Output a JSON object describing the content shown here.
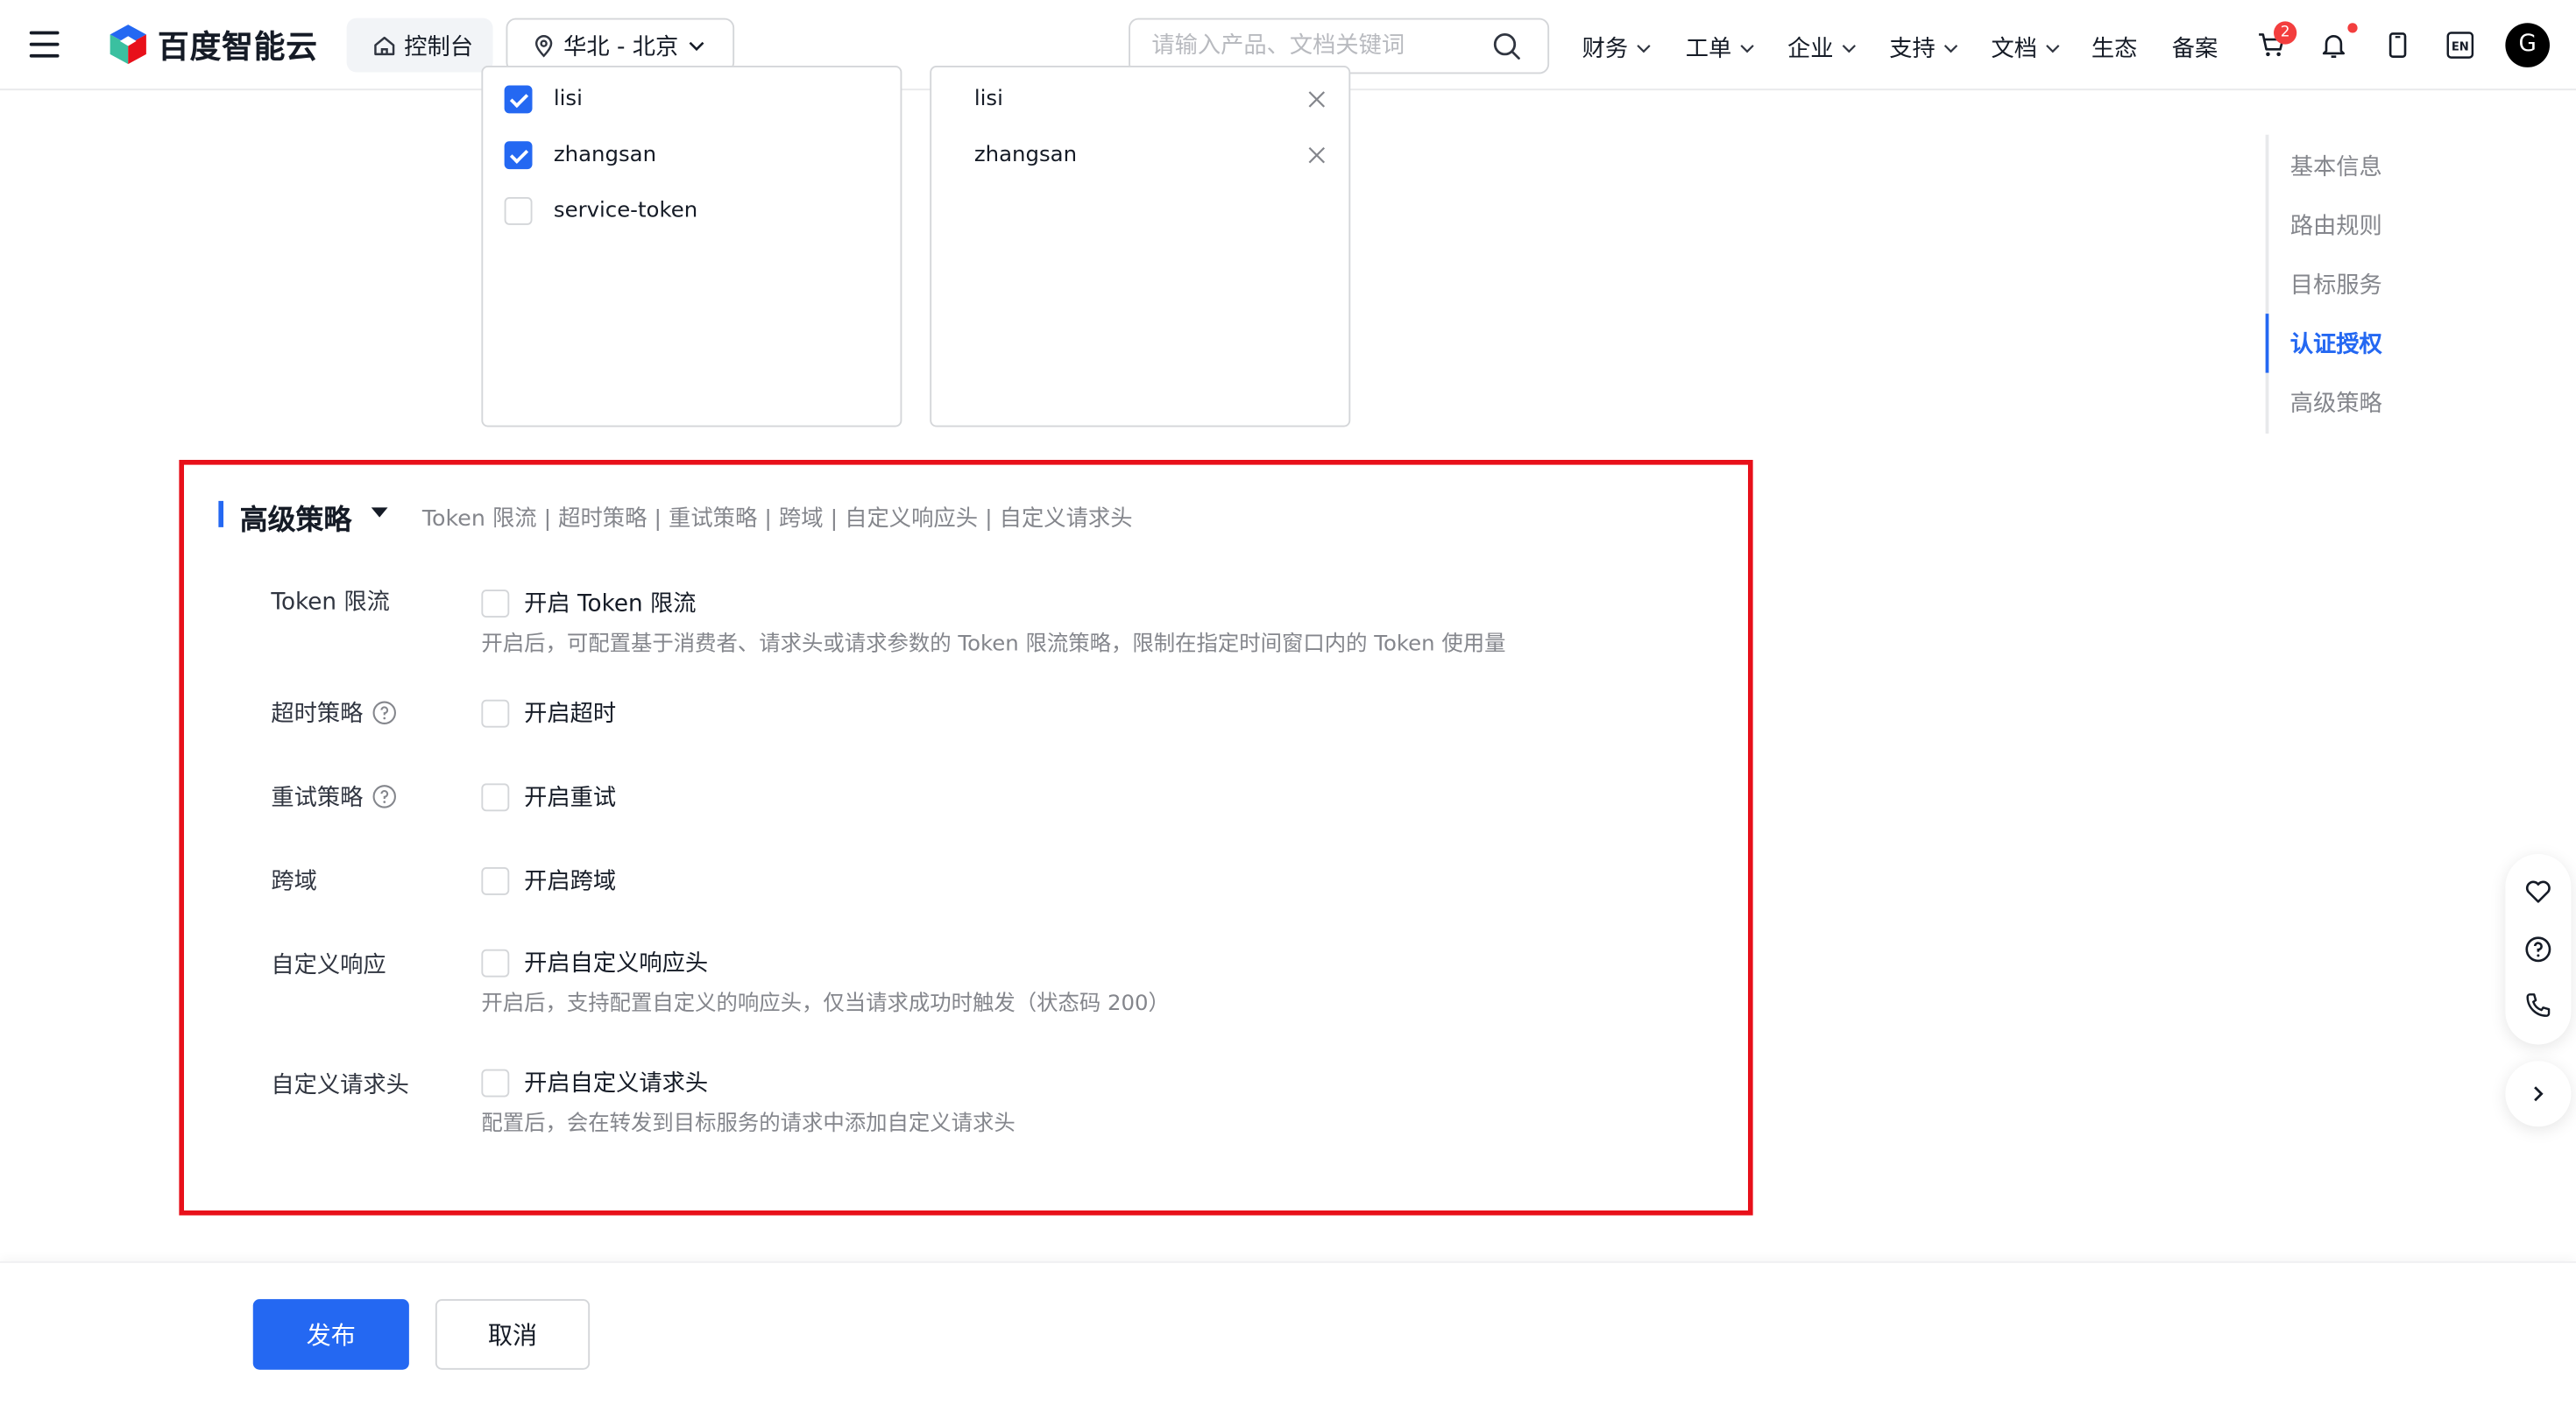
{
  "nav": {
    "brand": "百度智能云",
    "console": "控制台",
    "region": "华北 - 北京",
    "search_placeholder": "请输入产品、文档关键词",
    "menus": [
      "财务",
      "工单",
      "企业",
      "支持",
      "文档",
      "生态",
      "备案"
    ],
    "cart_count": "2",
    "lang": "EN",
    "avatar_letter": "G"
  },
  "transfer": {
    "source_items": [
      {
        "label": "lisi",
        "checked": true
      },
      {
        "label": "zhangsan",
        "checked": true
      },
      {
        "label": "service-token",
        "checked": false
      }
    ],
    "target_items": [
      {
        "label": "lisi"
      },
      {
        "label": "zhangsan"
      }
    ]
  },
  "anchor_nav": {
    "items": [
      "基本信息",
      "路由规则",
      "目标服务",
      "认证授权",
      "高级策略"
    ],
    "active": "认证授权"
  },
  "advanced": {
    "title": "高级策略",
    "subtitle": "Token 限流 | 超时策略 | 重试策略 | 跨域 | 自定义响应头 | 自定义请求头",
    "rows": [
      {
        "label": "Token 限流",
        "checkbox": "开启 Token 限流",
        "checked": false,
        "help": false,
        "desc": "开启后，可配置基于消费者、请求头或请求参数的 Token 限流策略，限制在指定时间窗口内的 Token 使用量"
      },
      {
        "label": "超时策略",
        "checkbox": "开启超时",
        "checked": false,
        "help": true,
        "desc": ""
      },
      {
        "label": "重试策略",
        "checkbox": "开启重试",
        "checked": false,
        "help": true,
        "desc": ""
      },
      {
        "label": "跨域",
        "checkbox": "开启跨域",
        "checked": false,
        "help": false,
        "desc": ""
      },
      {
        "label": "自定义响应",
        "checkbox": "开启自定义响应头",
        "checked": false,
        "help": false,
        "desc": "开启后，支持配置自定义的响应头，仅当请求成功时触发（状态码 200）"
      },
      {
        "label": "自定义请求头",
        "checkbox": "开启自定义请求头",
        "checked": false,
        "help": false,
        "desc": "配置后，会在转发到目标服务的请求中添加自定义请求头"
      }
    ]
  },
  "footer": {
    "publish": "发布",
    "cancel": "取消"
  },
  "colors": {
    "primary": "#2468f2",
    "highlight_frame": "#e8101a",
    "badge": "#f33e3e"
  }
}
